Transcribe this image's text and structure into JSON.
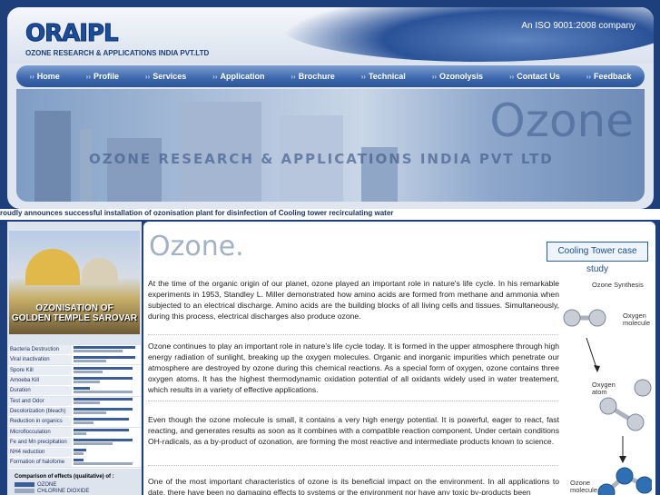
{
  "header": {
    "logo": "ORAIPL",
    "company": "OZONE RESEARCH & APPLICATIONS INDIA PVT.LTD",
    "iso": "An ISO 9001:2008 company"
  },
  "nav": {
    "items": [
      "Home",
      "Profile",
      "Services",
      "Application",
      "Brochure",
      "Technical",
      "Ozonolysis",
      "Contact Us",
      "Feedback"
    ]
  },
  "banner": {
    "word": "Ozone",
    "tagline": "OZONE RESEARCH & APPLICATIONS INDIA  PVT LTD"
  },
  "ticker": "roudly announces successful installation of ozonisation plant for disinfection of Cooling tower recirculating water",
  "sidebar": {
    "temple_caption_1": "OZONISATION OF",
    "temple_caption_2": "GOLDEN TEMPLE SAROVAR",
    "effects": [
      {
        "label": "Bacteria Destruction",
        "ozone": 0.95,
        "chlorine": 0.75
      },
      {
        "label": "Viral inactivation",
        "ozone": 0.95,
        "chlorine": 0.5
      },
      {
        "label": "Spore Kill",
        "ozone": 0.9,
        "chlorine": 0.45
      },
      {
        "label": "Amoeba Kill",
        "ozone": 0.9,
        "chlorine": 0.4
      },
      {
        "label": "Duration",
        "ozone": 0.25,
        "chlorine": 0.9
      },
      {
        "label": "Test and Odor",
        "ozone": 0.9,
        "chlorine": 0.4
      },
      {
        "label": "Decolorization (bleach)",
        "ozone": 0.9,
        "chlorine": 0.5
      },
      {
        "label": "Reduction in organics",
        "ozone": 0.85,
        "chlorine": 0.3
      },
      {
        "label": "Microflocculation",
        "ozone": 0.85,
        "chlorine": 0.2
      },
      {
        "label": "Fe and Mn precipitation",
        "ozone": 0.9,
        "chlorine": 0.6
      },
      {
        "label": "NH4 reduction",
        "ozone": 0.2,
        "chlorine": 0.15
      },
      {
        "label": "Formation of halofome",
        "ozone": 0.15,
        "chlorine": 0.9
      }
    ],
    "legend_title": "Comparison of effects (qualitative) of :",
    "legend": [
      {
        "name": "OZONE",
        "color": "#3b5e9a"
      },
      {
        "name": "CHLORINE DIOXIDE",
        "color": "#9aa8bf"
      }
    ]
  },
  "main": {
    "title": "Ozone.",
    "case_study": "Cooling Tower case study",
    "paragraphs": [
      "At the time of the organic origin of our planet, ozone played an important role in nature's life cycle. In his remarkable experiments in 1953, Standley L. Miller demonstrated how amino acids are formed from methane and ammonia when subjected to an electrical discharge. Amino acids are the building blocks of all living cells and tissues. Simultaneously, during this process, electrical discharges also produce ozone.",
      "Ozone continues to play an important role in nature's life cycle today. It is formed in the upper atmosphere through high energy radiation of sunlight, breaking up the oxygen molecules. Organic and inorganic impurities which penetrate our atmosphere are destroyed by ozone during this chemical reactions. As a special form of oxygen, ozone contains three oxygen atoms. It has the highest thermodynamic oxidation potential of all oxidants widely used in water treatement, which results in a variety of effective applications.",
      "Even though the ozone molecule is small, it contains a very high energy potential. It is powerful, eager to react, fast reacting, and generates results as soon as it combines with a compatible reaction component. Under certain conditions OH-radicals, as a by-product of ozonation, are forming the most reactive and intermediate products known to science.",
      "One of the most important characteristics of ozone is its beneficial impact on the environment. In all applications to date, there have been no damaging effects to systems or the environment nor have any toxic by-products been"
    ],
    "diagram": {
      "title": "Ozone Synthesis",
      "oxygen_molecule_1": "Oxygen",
      "oxygen_molecule_2": "molecule",
      "oxygen_atom_1": "Oxygen",
      "oxygen_atom_2": "atom",
      "ozone_molecule_1": "Ozone",
      "ozone_molecule_2": "molecule"
    }
  }
}
